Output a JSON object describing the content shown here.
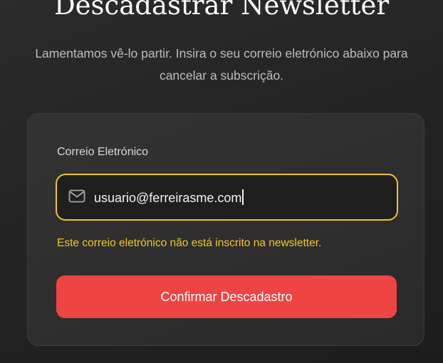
{
  "page": {
    "title": "Descadastrar Newsletter",
    "subtitle": "Lamentamos vê-lo partir. Insira o seu correio eletrónico abaixo para cancelar a subscrição."
  },
  "form": {
    "email_label": "Correio Eletrónico",
    "email_value": "usuario@ferreirasme.com",
    "email_icon": "mail-icon",
    "error_message": "Este correio eletrónico não está inscrito na newsletter.",
    "submit_label": "Confirmar Descadastro"
  },
  "colors": {
    "accent_focus": "#f2c526",
    "error": "#f2c526",
    "button": "#ef4444",
    "background": "#222222"
  }
}
